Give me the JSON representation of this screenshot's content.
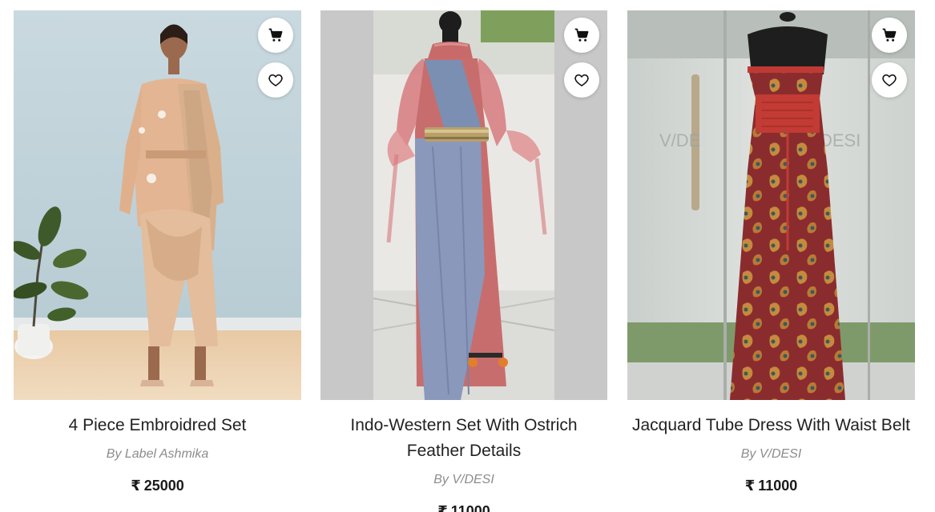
{
  "products": [
    {
      "title": "4 Piece Embroidred Set",
      "brand": "By Label Ashmika",
      "currency": "₹",
      "price": "25000",
      "image": "model-in-peach-drape-set"
    },
    {
      "title": "Indo-Western Set With Ostrich Feather Details",
      "brand": "By V/DESI",
      "currency": "₹",
      "price": "11000",
      "image": "mannequin-in-grey-pink-saree-gown"
    },
    {
      "title": "Jacquard Tube Dress With Waist Belt",
      "brand": "By V/DESI",
      "currency": "₹",
      "price": "11000",
      "image": "mannequin-in-red-jacquard-tube-dress"
    }
  ],
  "icons": {
    "cart": "shopping-cart-icon",
    "wishlist": "heart-icon"
  }
}
